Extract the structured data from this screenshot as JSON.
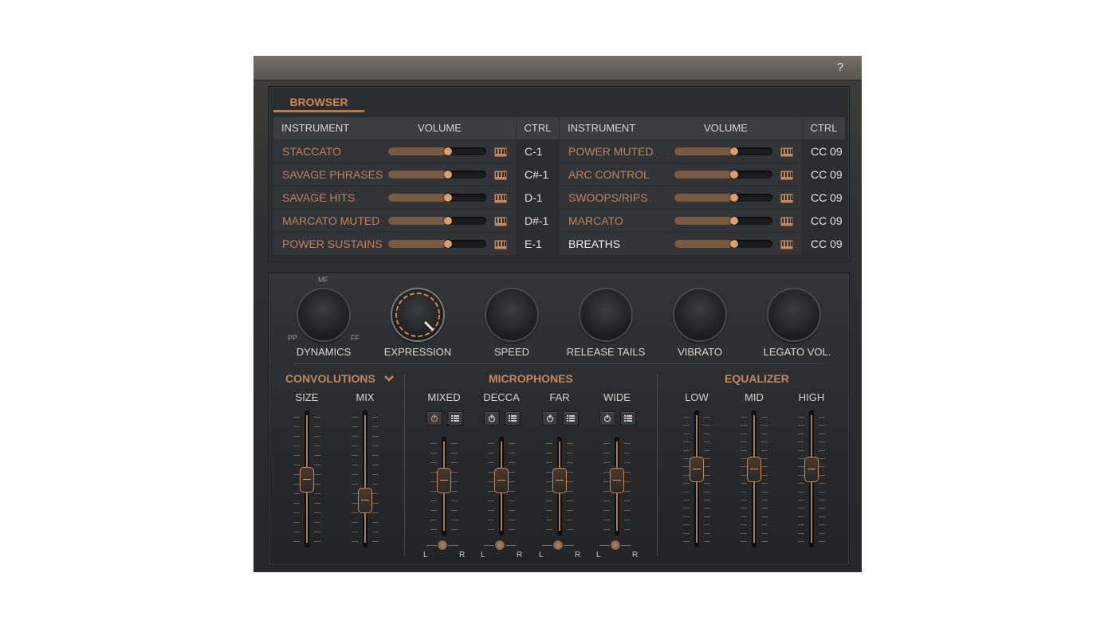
{
  "titlebar": {
    "help": "?"
  },
  "browser": {
    "tab": "BROWSER",
    "headers": {
      "instrument": "INSTRUMENT",
      "volume": "VOLUME",
      "ctrl": "CTRL"
    },
    "left_rows": [
      {
        "name": "STACCATO",
        "ctrl": "C-1",
        "volume": 0.6
      },
      {
        "name": "SAVAGE PHRASES",
        "ctrl": "C#-1",
        "volume": 0.6
      },
      {
        "name": "SAVAGE HITS",
        "ctrl": "D-1",
        "volume": 0.6
      },
      {
        "name": "MARCATO MUTED",
        "ctrl": "D#-1",
        "volume": 0.6
      },
      {
        "name": "POWER SUSTAINS",
        "ctrl": "E-1",
        "volume": 0.6
      }
    ],
    "right_rows": [
      {
        "name": "POWER MUTED",
        "ctrl": "CC 09",
        "volume": 0.6
      },
      {
        "name": "ARC CONTROL",
        "ctrl": "CC 09",
        "volume": 0.6
      },
      {
        "name": "SWOOPS/RIPS",
        "ctrl": "CC 09",
        "volume": 0.6
      },
      {
        "name": "MARCATO",
        "ctrl": "CC 09",
        "volume": 0.6
      },
      {
        "name": "BREATHS",
        "ctrl": "CC 09",
        "volume": 0.6,
        "highlight": true
      }
    ]
  },
  "knobs": {
    "dynamics": {
      "label": "DYNAMICS",
      "scale_top": "MF",
      "scale_left": "PP",
      "scale_right": "FF"
    },
    "expression": {
      "label": "EXPRESSION"
    },
    "speed": {
      "label": "SPEED"
    },
    "release": {
      "label": "RELEASE TAILS"
    },
    "vibrato": {
      "label": "VIBRATO"
    },
    "legato": {
      "label": "LEGATO VOL."
    }
  },
  "convolutions": {
    "title": "CONVOLUTIONS",
    "faders": [
      {
        "label": "SIZE",
        "value": 0.5
      },
      {
        "label": "MIX",
        "value": 0.3
      }
    ]
  },
  "microphones": {
    "title": "MICROPHONES",
    "pan_left": "L",
    "pan_right": "R",
    "channels": [
      {
        "label": "MIXED",
        "value": 0.6,
        "pan": 0.5
      },
      {
        "label": "DECCA",
        "value": 0.6,
        "pan": 0.5
      },
      {
        "label": "FAR",
        "value": 0.6,
        "pan": 0.5
      },
      {
        "label": "WIDE",
        "value": 0.6,
        "pan": 0.5
      }
    ]
  },
  "equalizer": {
    "title": "EQUALIZER",
    "bands": [
      {
        "label": "LOW",
        "value": 0.6
      },
      {
        "label": "MID",
        "value": 0.6
      },
      {
        "label": "HIGH",
        "value": 0.6
      }
    ]
  },
  "colors": {
    "accent": "#c6875a",
    "panel": "#2a2b2d"
  }
}
